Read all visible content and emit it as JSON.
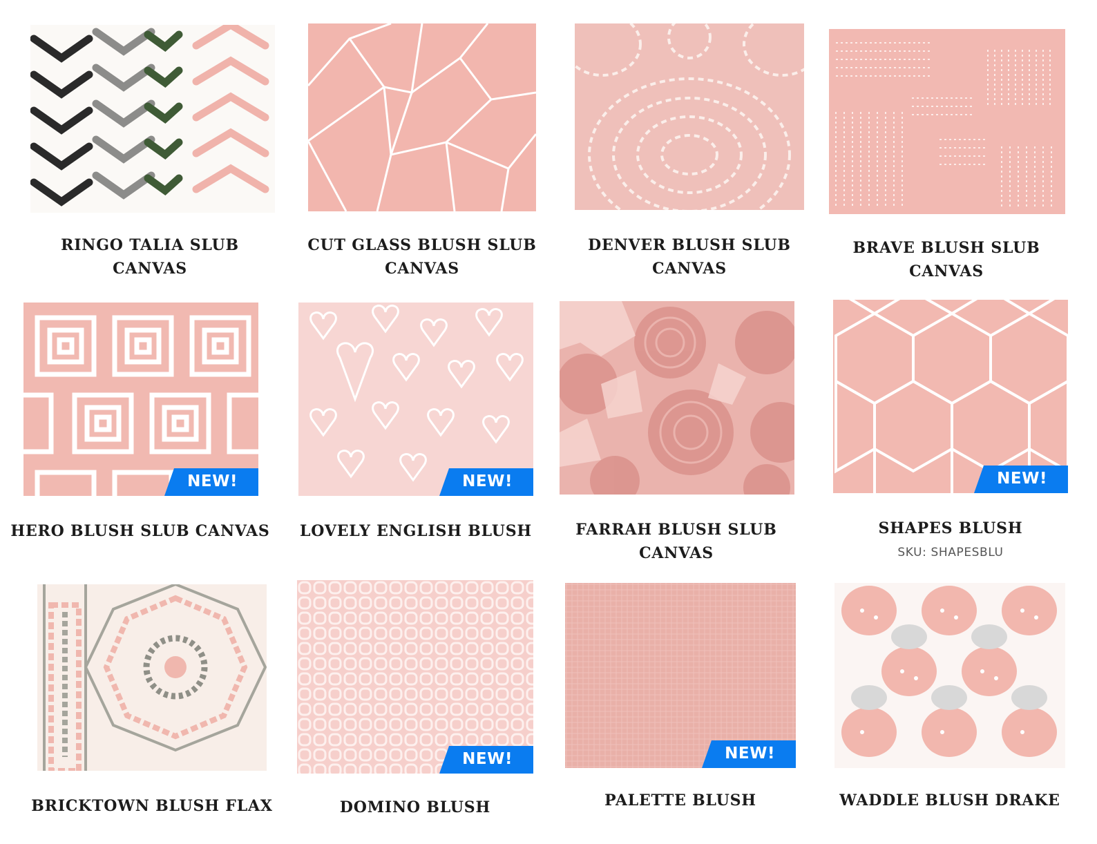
{
  "products": [
    {
      "name": "RINGO TALIA SLUB CANVAS"
    },
    {
      "name": "CUT GLASS BLUSH SLUB CANVAS"
    },
    {
      "name": "DENVER BLUSH SLUB CANVAS"
    },
    {
      "name": "BRAVE BLUSH SLUB CANVAS"
    },
    {
      "name": "HERO BLUSH SLUB CANVAS",
      "badge": "NEW!"
    },
    {
      "name": "LOVELY ENGLISH BLUSH",
      "badge": "NEW!"
    },
    {
      "name": "FARRAH BLUSH SLUB CANVAS"
    },
    {
      "name": "SHAPES BLUSH",
      "sku": "SKU: SHAPESBLU",
      "badge": "NEW!"
    },
    {
      "name": "BRICKTOWN BLUSH FLAX"
    },
    {
      "name": "DOMINO BLUSH",
      "badge": "NEW!"
    },
    {
      "name": "PALETTE BLUSH",
      "badge": "NEW!"
    },
    {
      "name": "WADDLE BLUSH DRAKE"
    }
  ],
  "colors": {
    "blush": "#f2bcb6",
    "badge_blue": "#0a7cf0",
    "text": "#1c1c1c"
  }
}
